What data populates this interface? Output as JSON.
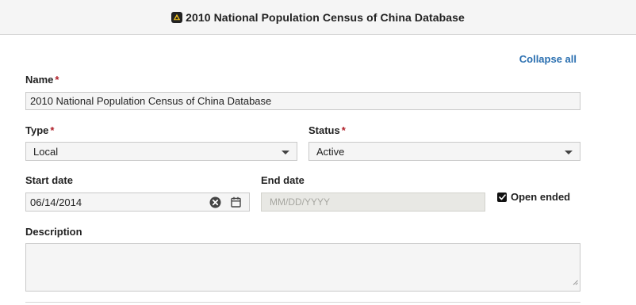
{
  "header": {
    "title": "2010 National Population Census of China Database",
    "icon": "resource-icon"
  },
  "actions": {
    "collapse_all": "Collapse all"
  },
  "form": {
    "name": {
      "label": "Name",
      "required_mark": "*",
      "value": "2010 National Population Census of China Database"
    },
    "type": {
      "label": "Type",
      "required_mark": "*",
      "value": "Local"
    },
    "status": {
      "label": "Status",
      "required_mark": "*",
      "value": "Active"
    },
    "start_date": {
      "label": "Start date",
      "value": "06/14/2014"
    },
    "end_date": {
      "label": "End date",
      "placeholder": "MM/DD/YYYY"
    },
    "open_ended": {
      "label": "Open ended",
      "checked": true
    },
    "description": {
      "label": "Description",
      "value": ""
    }
  },
  "colors": {
    "link": "#2a6fb0",
    "required": "#b0202a",
    "field_bg": "#f5f5f5",
    "disabled_bg": "#e8e8e4"
  }
}
